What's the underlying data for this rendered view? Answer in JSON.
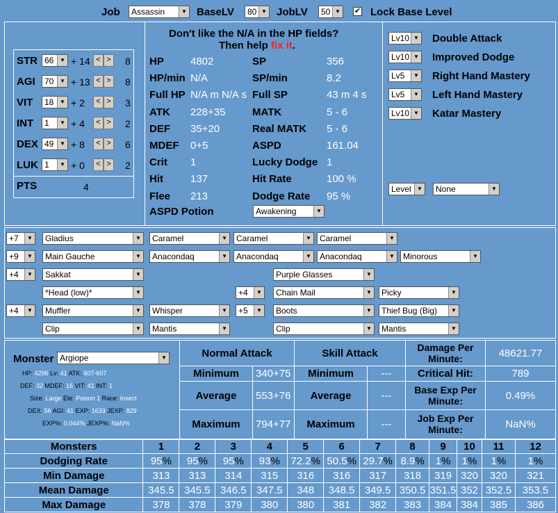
{
  "header": {
    "job_label": "Job",
    "job": "Assassin",
    "baselv_label": "BaseLV",
    "baselv": "80",
    "joblv_label": "JobLV",
    "joblv": "50",
    "lock_label": "Lock Base Level",
    "lock_checked": true
  },
  "stats": [
    {
      "name": "STR",
      "val": "66",
      "bonus": "+ 14",
      "cost": "8"
    },
    {
      "name": "AGI",
      "val": "70",
      "bonus": "+ 13",
      "cost": "8"
    },
    {
      "name": "VIT",
      "val": "18",
      "bonus": "+ 2",
      "cost": "3"
    },
    {
      "name": "INT",
      "val": "1",
      "bonus": "+ 4",
      "cost": "2"
    },
    {
      "name": "DEX",
      "val": "49",
      "bonus": "+ 8",
      "cost": "6"
    },
    {
      "name": "LUK",
      "val": "1",
      "bonus": "+ 0",
      "cost": "2"
    }
  ],
  "pts_label": "PTS",
  "pts": "4",
  "notice": {
    "line1": "Don't like the N/A in the HP fields?",
    "line2a": "Then help ",
    "link": "fix it",
    "line2b": "."
  },
  "calc": [
    {
      "l": "HP",
      "v": "4802",
      "l2": "SP",
      "v2": "356"
    },
    {
      "l": "HP/min",
      "v": "N/A",
      "l2": "SP/min",
      "v2": "8.2"
    },
    {
      "l": "Full HP",
      "v": "N/A m N/A s",
      "l2": "Full SP",
      "v2": "43 m 4 s"
    },
    {
      "l": "ATK",
      "v": "228+35",
      "l2": "MATK",
      "v2": "5 - 6"
    },
    {
      "l": "DEF",
      "v": "35+20",
      "l2": "Real MATK",
      "v2": "5 - 6"
    },
    {
      "l": "MDEF",
      "v": "0+5",
      "l2": "ASPD",
      "v2": "161.04"
    },
    {
      "l": "Crit",
      "v": "1",
      "l2": "Lucky Dodge",
      "v2": "1"
    },
    {
      "l": "Hit",
      "v": "137",
      "l2": "Hit Rate",
      "v2": "100 %"
    },
    {
      "l": "Flee",
      "v": "213",
      "l2": "Dodge Rate",
      "v2": "95 %"
    }
  ],
  "aspd_potion_label": "ASPD Potion",
  "aspd_potion": "Awakening",
  "skills": [
    {
      "lv": "Lv10",
      "name": "Double Attack"
    },
    {
      "lv": "Lv10",
      "name": "Improved Dodge"
    },
    {
      "lv": "Lv5",
      "name": "Right Hand Mastery"
    },
    {
      "lv": "Lv5",
      "name": "Left Hand Mastery"
    },
    {
      "lv": "Lv10",
      "name": "Katar Mastery"
    }
  ],
  "extra_skill": {
    "level": "Level",
    "name": "None"
  },
  "equip": {
    "r1": [
      "+7",
      "Gladius",
      "Caramel",
      "Caramel",
      "Caramel"
    ],
    "r2": [
      "+9",
      "Main Gauche",
      "Anacondaq",
      "Anacondaq",
      "Anacondaq",
      "Minorous"
    ],
    "r3": [
      "+4",
      "Sakkat",
      "Purple Glasses"
    ],
    "r4": [
      "*Head (low)*",
      "+4",
      "Chain Mail",
      "Picky"
    ],
    "r5": [
      "+4",
      "Muffler",
      "Whisper",
      "+5",
      "Boots",
      "Thief Bug (Big)"
    ],
    "r6": [
      "Clip",
      "Mantis",
      "Clip",
      "Mantis"
    ]
  },
  "monster": {
    "label": "Monster",
    "name": "Argiope",
    "l1": [
      [
        "HP: ",
        "4296"
      ],
      [
        " Lv: ",
        "41"
      ],
      [
        " ATK: ",
        "607-607"
      ]
    ],
    "l2": [
      [
        "DEF: ",
        "32"
      ],
      [
        " MDEF: ",
        "16"
      ],
      [
        " VIT: ",
        "41"
      ],
      [
        " INT: ",
        "1"
      ]
    ],
    "l3": [
      [
        "Size: ",
        "Large"
      ],
      [
        " Ele: ",
        "Poison 1"
      ],
      [
        " Race: ",
        "Insect"
      ]
    ],
    "l4": [
      [
        "DEX: ",
        "56"
      ],
      [
        " AGI: ",
        "41"
      ],
      [
        " EXP: ",
        "1633"
      ],
      [
        " JEXP: ",
        "829"
      ]
    ],
    "l5": [
      [
        "EXP%: ",
        "0.044%"
      ],
      [
        " JEXP%: ",
        "NaN%"
      ]
    ]
  },
  "attack": {
    "normal": "Normal Attack",
    "skill": "Skill Attack",
    "min": "Minimum",
    "avg": "Average",
    "max": "Maximum",
    "nmin": "340+75",
    "navg": "553+76",
    "nmax": "794+77",
    "smin": "---",
    "savg": "---",
    "smax": "---",
    "dpm_label": "Damage Per Minute:",
    "dpm": "48621.77",
    "crit_label": "Critical Hit:",
    "crit": "789",
    "bexp_label": "Base Exp Per Minute:",
    "bexp": "0.49%",
    "jexp_label": "Job Exp Per Minute:",
    "jexp": "NaN%"
  },
  "bottom": {
    "cols": [
      "Monsters",
      "1",
      "2",
      "3",
      "4",
      "5",
      "6",
      "7",
      "8",
      "9",
      "10",
      "11",
      "12"
    ],
    "rows": [
      {
        "label": "Dodging Rate",
        "cells": [
          "95%",
          "95%",
          "95%",
          "93%",
          "72.2%",
          "50.5%",
          "29.7%",
          "8.9%",
          "1%",
          "1%",
          "1%",
          "1%"
        ]
      },
      {
        "label": "Min Damage",
        "cells": [
          "313",
          "313",
          "314",
          "315",
          "316",
          "316",
          "317",
          "318",
          "319",
          "320",
          "320",
          "321"
        ]
      },
      {
        "label": "Mean Damage",
        "cells": [
          "345.5",
          "345.5",
          "346.5",
          "347.5",
          "348",
          "348.5",
          "349.5",
          "350.5",
          "351.5",
          "352",
          "352.5",
          "353.5"
        ]
      },
      {
        "label": "Max Damage",
        "cells": [
          "378",
          "378",
          "379",
          "380",
          "380",
          "381",
          "382",
          "383",
          "384",
          "384",
          "385",
          "386"
        ]
      }
    ]
  }
}
